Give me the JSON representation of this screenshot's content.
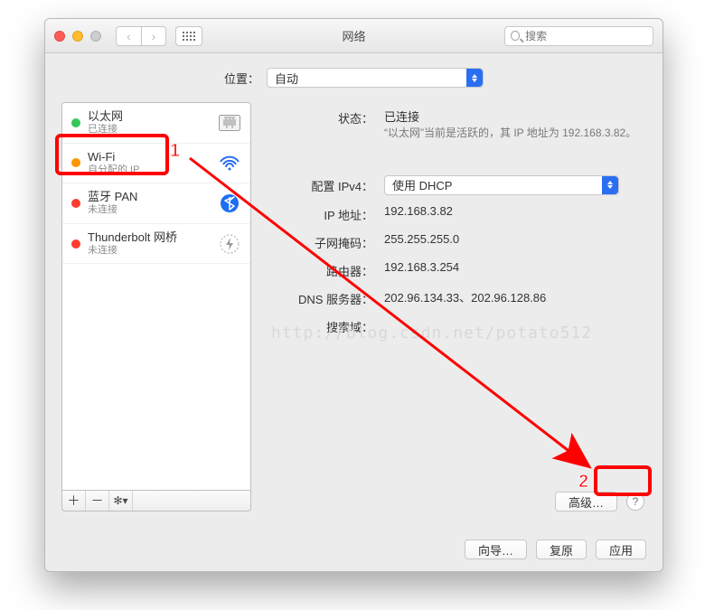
{
  "title": "网络",
  "search_placeholder": "搜索",
  "location": {
    "label": "位置：",
    "value": "自动"
  },
  "sidebar": {
    "items": [
      {
        "name": "以太网",
        "status": "已连接",
        "bullet": "green",
        "icon": "ethernet"
      },
      {
        "name": "Wi-Fi",
        "status": "自分配的 IP",
        "bullet": "orange",
        "icon": "wifi"
      },
      {
        "name": "蓝牙 PAN",
        "status": "未连接",
        "bullet": "redb",
        "icon": "bluetooth"
      },
      {
        "name": "Thunderbolt 网桥",
        "status": "未连接",
        "bullet": "redb",
        "icon": "thunderbolt"
      }
    ]
  },
  "detail": {
    "status_label": "状态：",
    "status_value": "已连接",
    "status_desc": "“以太网”当前是活跃的，其 IP 地址为 192.168.3.82。",
    "rows": {
      "configure_ipv4_label": "配置 IPv4：",
      "configure_ipv4_value": "使用 DHCP",
      "ip_label": "IP 地址：",
      "ip_value": "192.168.3.82",
      "mask_label": "子网掩码：",
      "mask_value": "255.255.255.0",
      "router_label": "路由器：",
      "router_value": "192.168.3.254",
      "dns_label": "DNS 服务器：",
      "dns_value": "202.96.134.33、202.96.128.86",
      "search_label": "搜索域："
    },
    "advanced_label": "高级…"
  },
  "footer": {
    "wizard": "向导…",
    "revert": "复原",
    "apply": "应用"
  },
  "annotation": {
    "one": "1",
    "two": "2"
  },
  "watermark": "http://blog.csdn.net/potato512"
}
